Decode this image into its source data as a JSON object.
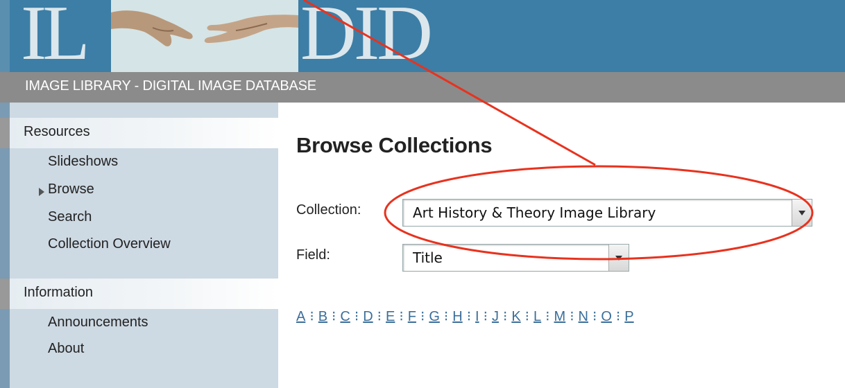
{
  "header": {
    "logo_left": "IL",
    "logo_right": "DID",
    "subtitle": "IMAGE LIBRARY - DIGITAL IMAGE DATABASE"
  },
  "sidebar": {
    "sections": [
      {
        "heading": "Resources",
        "items": [
          "Slideshows",
          "Browse",
          "Search",
          "Collection Overview"
        ]
      },
      {
        "heading": "Information",
        "items": [
          "Announcements",
          "About"
        ]
      }
    ],
    "active_item": "Browse"
  },
  "main": {
    "title": "Browse Collections",
    "collection_label": "Collection:",
    "collection_value": "Art History & Theory Image Library",
    "field_label": "Field:",
    "field_value": "Title",
    "letters": [
      "A",
      "B",
      "C",
      "D",
      "E",
      "F",
      "G",
      "H",
      "I",
      "J",
      "K",
      "L",
      "M",
      "N",
      "O",
      "P"
    ]
  },
  "colors": {
    "header_blue": "#3c7ea6",
    "annotation_red": "#e8321e",
    "link_blue": "#3a6e9a"
  }
}
